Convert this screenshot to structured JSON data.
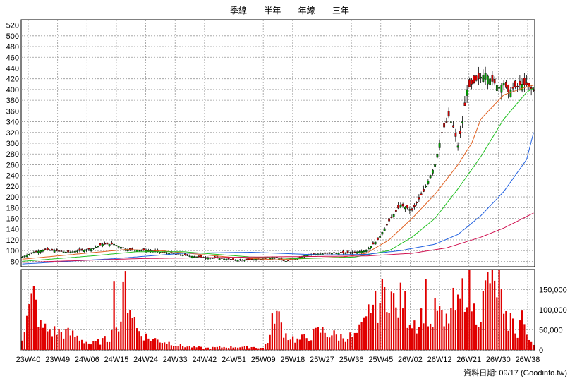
{
  "legend": [
    {
      "label": "季線",
      "color": "#e06020"
    },
    {
      "label": "半年",
      "color": "#20c020"
    },
    {
      "label": "年線",
      "color": "#2060e0"
    },
    {
      "label": "三年",
      "color": "#d01050"
    }
  ],
  "credit": "資料日期: 09/17  (Goodinfo.tw)",
  "colors": {
    "up": "#00a000",
    "down": "#e00000",
    "volume": "#e00000",
    "grid": "#999999"
  },
  "chart_data": [
    {
      "type": "line",
      "name": "price",
      "ylim": [
        70,
        530
      ],
      "yticks": [
        80,
        100,
        120,
        140,
        160,
        180,
        200,
        220,
        240,
        260,
        280,
        300,
        320,
        340,
        360,
        380,
        400,
        420,
        440,
        460,
        480,
        500,
        520
      ],
      "xticklabels": [
        "23W40",
        "23W49",
        "24W06",
        "24W15",
        "24W24",
        "24W33",
        "24W42",
        "24W51",
        "25W09",
        "25W18",
        "25W27",
        "25W36",
        "25W45",
        "26W02",
        "26W12",
        "26W21",
        "26W30",
        "26W38"
      ],
      "close_anchors": [
        [
          0,
          88
        ],
        [
          5,
          97
        ],
        [
          10,
          102
        ],
        [
          20,
          97
        ],
        [
          30,
          103
        ],
        [
          35,
          112
        ],
        [
          40,
          112
        ],
        [
          45,
          103
        ],
        [
          55,
          100
        ],
        [
          65,
          95
        ],
        [
          75,
          89
        ],
        [
          85,
          86
        ],
        [
          95,
          82
        ],
        [
          105,
          85
        ],
        [
          110,
          88
        ],
        [
          115,
          80
        ],
        [
          125,
          93
        ],
        [
          135,
          95
        ],
        [
          145,
          97
        ],
        [
          150,
          100
        ],
        [
          155,
          120
        ],
        [
          160,
          155
        ],
        [
          165,
          185
        ],
        [
          170,
          175
        ],
        [
          175,
          210
        ],
        [
          180,
          260
        ],
        [
          183,
          320
        ],
        [
          186,
          350
        ],
        [
          188,
          330
        ],
        [
          190,
          295
        ],
        [
          192,
          340
        ],
        [
          194,
          400
        ],
        [
          196,
          410
        ],
        [
          199,
          420
        ],
        [
          202,
          430
        ],
        [
          205,
          415
        ],
        [
          208,
          405
        ],
        [
          210,
          412
        ],
        [
          212,
          395
        ],
        [
          214,
          402
        ],
        [
          218,
          410
        ],
        [
          220,
          408
        ],
        [
          223,
          398
        ]
      ],
      "series": [
        {
          "name": "季線",
          "anchors": [
            [
              0,
              84
            ],
            [
              30,
              96
            ],
            [
              45,
              102
            ],
            [
              60,
              100
            ],
            [
              90,
              88
            ],
            [
              110,
              83
            ],
            [
              140,
              88
            ],
            [
              150,
              95
            ],
            [
              160,
              120
            ],
            [
              170,
              160
            ],
            [
              180,
              205
            ],
            [
              190,
              260
            ],
            [
              196,
              300
            ],
            [
              200,
              345
            ],
            [
              210,
              390
            ],
            [
              220,
              405
            ],
            [
              223,
              408
            ]
          ]
        },
        {
          "name": "半年",
          "anchors": [
            [
              0,
              80
            ],
            [
              30,
              90
            ],
            [
              50,
              98
            ],
            [
              70,
              98
            ],
            [
              100,
              88
            ],
            [
              120,
              85
            ],
            [
              145,
              88
            ],
            [
              160,
              100
            ],
            [
              170,
              125
            ],
            [
              180,
              160
            ],
            [
              190,
              215
            ],
            [
              200,
              275
            ],
            [
              210,
              345
            ],
            [
              220,
              395
            ],
            [
              223,
              403
            ]
          ]
        },
        {
          "name": "年線",
          "anchors": [
            [
              0,
              75
            ],
            [
              40,
              85
            ],
            [
              70,
              95
            ],
            [
              100,
              97
            ],
            [
              130,
              92
            ],
            [
              150,
              93
            ],
            [
              165,
              100
            ],
            [
              180,
              112
            ],
            [
              190,
              130
            ],
            [
              200,
              165
            ],
            [
              210,
              210
            ],
            [
              220,
              270
            ],
            [
              223,
              320
            ]
          ]
        },
        {
          "name": "三年",
          "anchors": [
            [
              0,
              78
            ],
            [
              50,
              85
            ],
            [
              100,
              88
            ],
            [
              150,
              90
            ],
            [
              170,
              95
            ],
            [
              185,
              105
            ],
            [
              200,
              125
            ],
            [
              210,
              142
            ],
            [
              223,
              170
            ]
          ]
        }
      ]
    },
    {
      "type": "bar",
      "name": "volume",
      "ylim": [
        0,
        200000
      ],
      "yticks": [
        0,
        50000,
        100000,
        150000
      ],
      "yticklabels": [
        "0",
        "50,000",
        "100,000",
        "150,000"
      ],
      "volume_anchors": [
        [
          0,
          35000
        ],
        [
          3,
          102000
        ],
        [
          5,
          140000
        ],
        [
          8,
          60000
        ],
        [
          12,
          50000
        ],
        [
          18,
          45000
        ],
        [
          22,
          40000
        ],
        [
          30,
          15000
        ],
        [
          38,
          30000
        ],
        [
          40,
          145000
        ],
        [
          42,
          50000
        ],
        [
          45,
          170000
        ],
        [
          50,
          55000
        ],
        [
          55,
          30000
        ],
        [
          60,
          25000
        ],
        [
          70,
          10000
        ],
        [
          80,
          5000
        ],
        [
          90,
          8000
        ],
        [
          100,
          8000
        ],
        [
          105,
          5000
        ],
        [
          108,
          35000
        ],
        [
          110,
          105000
        ],
        [
          115,
          40000
        ],
        [
          120,
          25000
        ],
        [
          125,
          35000
        ],
        [
          130,
          50000
        ],
        [
          138,
          35000
        ],
        [
          145,
          35000
        ],
        [
          150,
          70000
        ],
        [
          152,
          125000
        ],
        [
          154,
          110000
        ],
        [
          158,
          145000
        ],
        [
          160,
          165000
        ],
        [
          163,
          100000
        ],
        [
          166,
          140000
        ],
        [
          168,
          90000
        ],
        [
          170,
          80000
        ],
        [
          173,
          70000
        ],
        [
          176,
          140000
        ],
        [
          178,
          60000
        ],
        [
          181,
          115000
        ],
        [
          184,
          60000
        ],
        [
          188,
          115000
        ],
        [
          190,
          105000
        ],
        [
          194,
          185000
        ],
        [
          197,
          100000
        ],
        [
          200,
          100000
        ],
        [
          202,
          150000
        ],
        [
          204,
          200000
        ],
        [
          206,
          150000
        ],
        [
          208,
          195000
        ],
        [
          210,
          70000
        ],
        [
          213,
          80000
        ],
        [
          216,
          45000
        ],
        [
          218,
          100000
        ],
        [
          220,
          30000
        ],
        [
          223,
          20000
        ]
      ]
    }
  ]
}
